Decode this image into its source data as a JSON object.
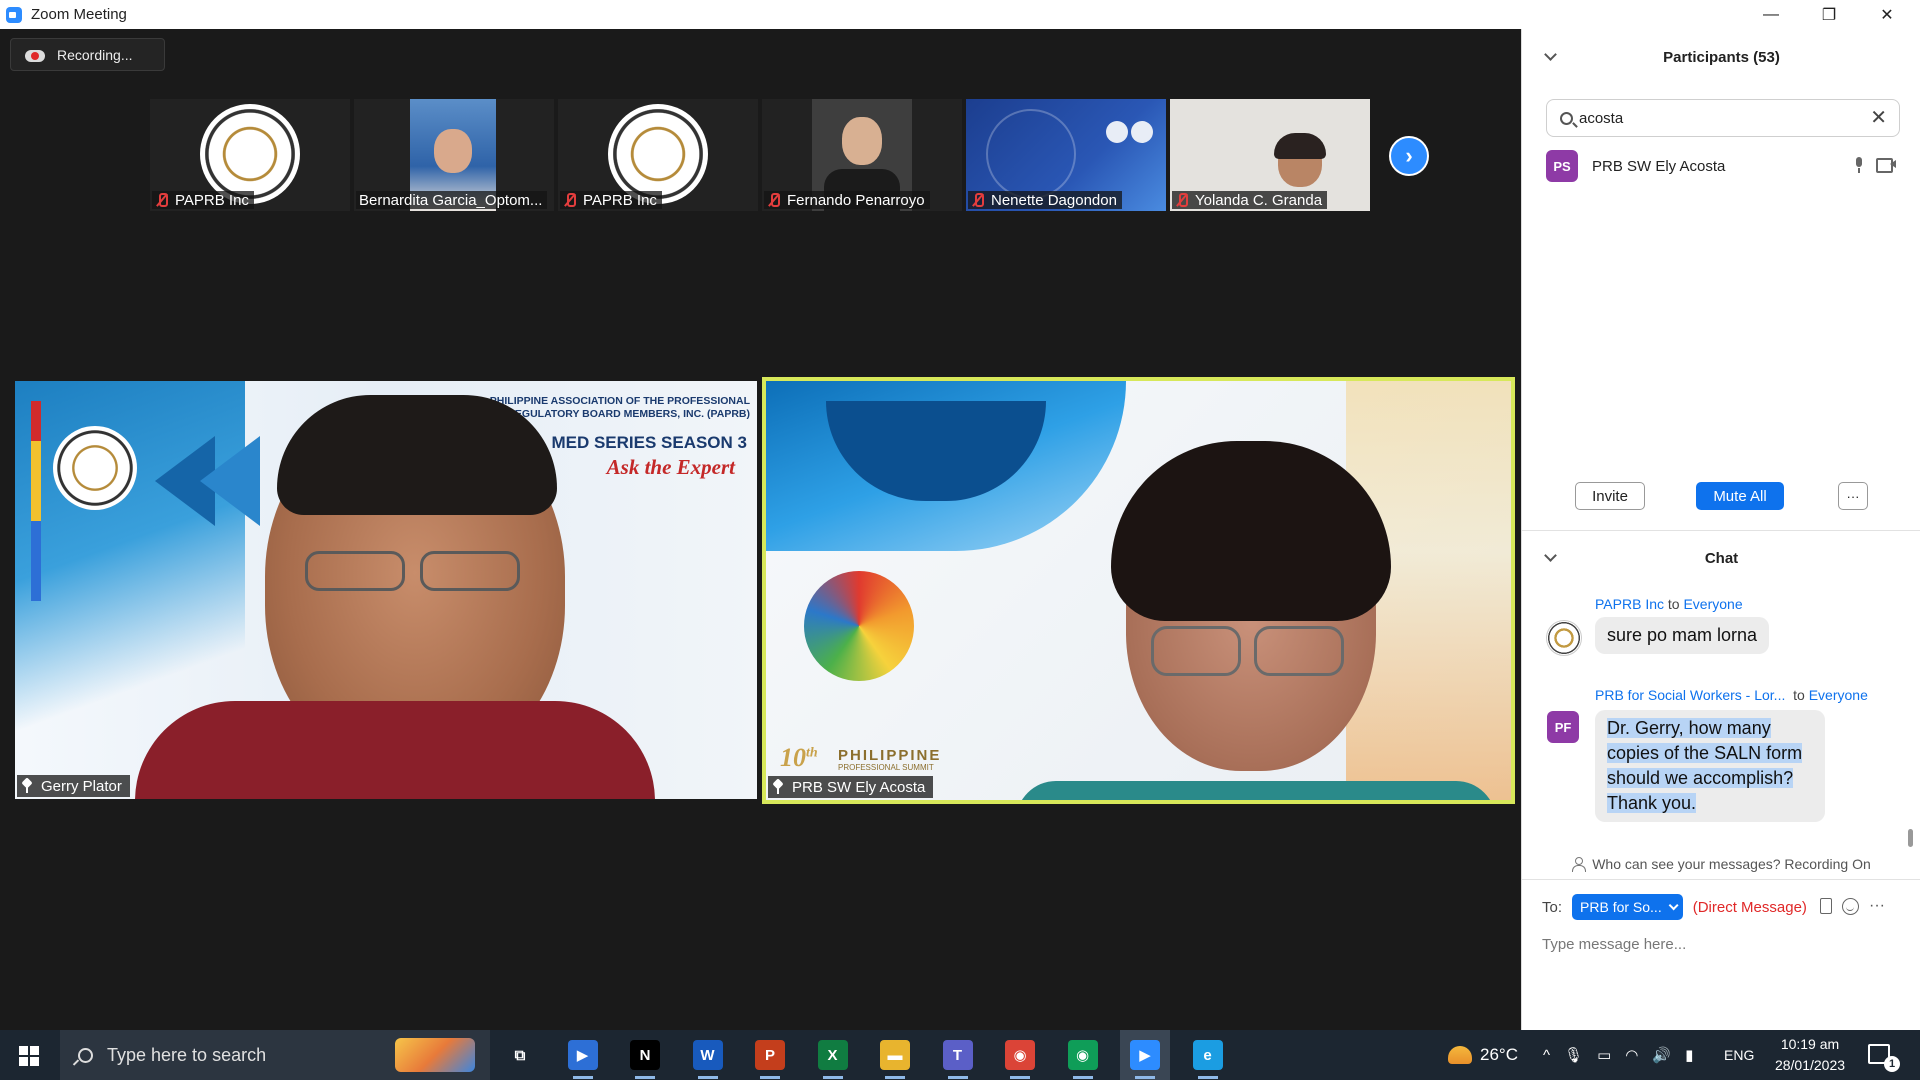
{
  "window": {
    "title": "Zoom Meeting",
    "minimize": "—",
    "restore": "❐",
    "close": "✕"
  },
  "recording": {
    "label": "Recording..."
  },
  "gallery": {
    "thumbnails": [
      {
        "name": "PAPRB Inc",
        "type": "logo"
      },
      {
        "name": "Bernardita Garcia_Optom...",
        "type": "photo"
      },
      {
        "name": "PAPRB Inc",
        "type": "logo"
      },
      {
        "name": "Fernando Penarroyo",
        "type": "photo"
      },
      {
        "name": "Nenette Dagondon",
        "type": "banner"
      },
      {
        "name": "Yolanda C. Granda",
        "type": "photo"
      }
    ],
    "next_icon": "›"
  },
  "main_tiles": {
    "left": {
      "name": "Gerry Plator",
      "banner_org": "PHILIPPINE ASSOCIATION OF THE PROFESSIONAL REGULATORY BOARD MEMBERS, INC. (PAPRB)",
      "banner_series": "MED SERIES SEASON 3",
      "banner_tagline": "Ask the Expert"
    },
    "right": {
      "name": "PRB SW Ely Acosta",
      "summit_number": "10",
      "summit_suffix": "th",
      "summit_title": "PHILIPPINE",
      "summit_subtitle": "PROFESSIONAL SUMMIT"
    }
  },
  "participants": {
    "header": "Participants (53)",
    "search_value": "acosta",
    "clear_icon": "✕",
    "list": [
      {
        "initials": "PS",
        "name": "PRB SW Ely Acosta",
        "color": "#8e3aa6"
      }
    ],
    "invite_label": "Invite",
    "mute_all_label": "Mute All",
    "more_label": "···"
  },
  "chat": {
    "header": "Chat",
    "messages": [
      {
        "sender": "PAPRB Inc",
        "to_word": "to",
        "recipient": "Everyone",
        "text": "sure po mam lorna"
      },
      {
        "sender": "PRB for Social Workers - Lor...",
        "to_word": "to",
        "recipient": "Everyone",
        "initials": "PF",
        "color": "#8e3aa6",
        "lines": [
          "Dr. Gerry, how many",
          "copies of the SALN form",
          "should we accomplish?",
          "Thank you."
        ]
      }
    ],
    "who_can_see": "Who can see your messages? Recording On",
    "to_label": "To:",
    "recipient_button": "PRB for So...",
    "direct_message": "(Direct Message)",
    "more_icon": "···",
    "input_placeholder": "Type message here..."
  },
  "taskbar": {
    "search_placeholder": "Type here to search",
    "apps": [
      {
        "name": "task-view",
        "glyph": "⧉",
        "color": "transparent"
      },
      {
        "name": "zoom-meetings",
        "glyph": "▶",
        "color": "#2d6fd6"
      },
      {
        "name": "netflix",
        "glyph": "N",
        "color": "#000000"
      },
      {
        "name": "word",
        "glyph": "W",
        "color": "#185abd"
      },
      {
        "name": "powerpoint",
        "glyph": "P",
        "color": "#c43e1c"
      },
      {
        "name": "excel",
        "glyph": "X",
        "color": "#107c41"
      },
      {
        "name": "file-explorer",
        "glyph": "▬",
        "color": "#e8b42e"
      },
      {
        "name": "teams",
        "glyph": "T",
        "color": "#5b5fc7"
      },
      {
        "name": "chrome",
        "glyph": "◉",
        "color": "#db4437"
      },
      {
        "name": "chrome-profile",
        "glyph": "◉",
        "color": "#0f9d58"
      },
      {
        "name": "zoom",
        "glyph": "▶",
        "color": "#2d8cff"
      },
      {
        "name": "edge",
        "glyph": "e",
        "color": "#1b9de2"
      }
    ],
    "weather_temp": "26°C",
    "language": "ENG",
    "time": "10:19 am",
    "date": "28/01/2023",
    "notification_count": "1"
  }
}
